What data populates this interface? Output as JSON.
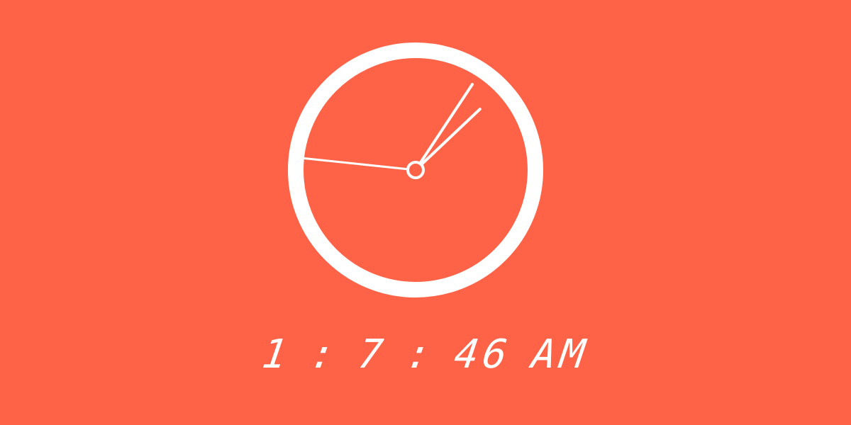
{
  "theme": {
    "background_color": "#FF6347",
    "foreground_color": "#FFFFFF"
  },
  "analog_clock": {
    "hour": 1,
    "minute": 7,
    "second": 46
  },
  "digital_clock": {
    "hours": "1",
    "separator_1": ":",
    "minutes": "7",
    "separator_2": ":",
    "seconds": "46",
    "period": "AM"
  }
}
